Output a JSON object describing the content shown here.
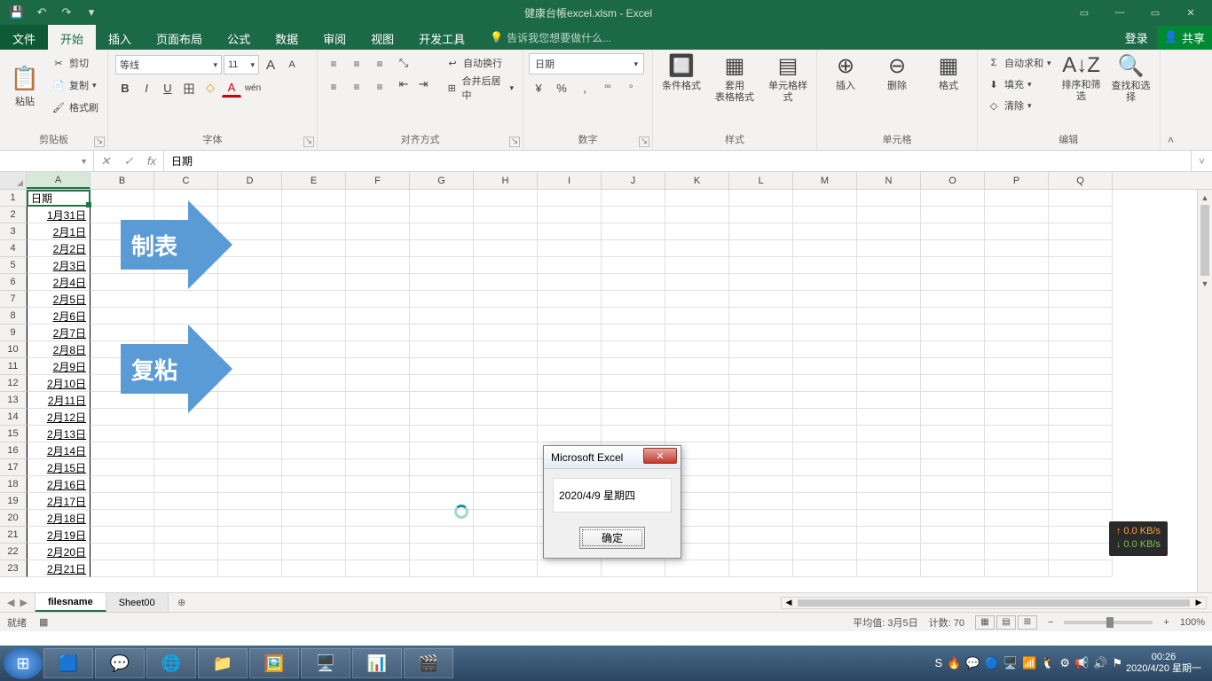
{
  "titlebar": {
    "filename": "健康台帳excel.xlsm - Excel"
  },
  "qat": {
    "save": "💾",
    "undo": "↶",
    "redo": "↷",
    "more": "▾"
  },
  "wincontrols": {
    "min": "—",
    "max": "▭",
    "close": "✕",
    "ribbonopts": "▭"
  },
  "menu": {
    "file": "文件",
    "home": "开始",
    "insert": "插入",
    "pagelayout": "页面布局",
    "formulas": "公式",
    "data": "数据",
    "review": "审阅",
    "view": "视图",
    "developer": "开发工具",
    "tellme": "告诉我您想要做什么...",
    "signin": "登录",
    "share": "共享"
  },
  "ribbon": {
    "clipboard": {
      "label": "剪贴板",
      "paste": "粘贴",
      "cut": "剪切",
      "copy": "复制",
      "painter": "格式刷",
      "paste_icon": "📋"
    },
    "font": {
      "label": "字体",
      "name": "等线",
      "size": "11",
      "bold": "B",
      "italic": "I",
      "underline": "U",
      "incfont": "A",
      "decfont": "A",
      "ruby": "wén",
      "border": "田",
      "fill": "▦",
      "color": "A"
    },
    "align": {
      "label": "对齐方式",
      "wrap": "自动换行",
      "merge": "合并后居中"
    },
    "number": {
      "label": "数字",
      "format": "日期",
      "currency": "¥",
      "percent": "%",
      "comma": ",",
      "inc": ".0→.00",
      "dec": ".00→.0"
    },
    "styles": {
      "label": "样式",
      "cond": "条件格式",
      "table": "套用\n表格格式",
      "cell": "单元格样式"
    },
    "cells": {
      "label": "单元格",
      "insert": "插入",
      "delete": "删除",
      "format": "格式"
    },
    "editing": {
      "label": "编辑",
      "sum": "自动求和",
      "fill": "填充",
      "clear": "清除",
      "sort": "排序和筛选",
      "find": "查找和选择"
    }
  },
  "namebox": "",
  "fx": {
    "cancel": "✕",
    "enter": "✓",
    "fx": "fx"
  },
  "formula": "日期",
  "columns": [
    "A",
    "B",
    "C",
    "D",
    "E",
    "F",
    "G",
    "H",
    "I",
    "J",
    "K",
    "L",
    "M",
    "N",
    "O",
    "P",
    "Q"
  ],
  "rownums": [
    "1",
    "2",
    "3",
    "4",
    "5",
    "6",
    "7",
    "8",
    "9",
    "10",
    "11",
    "12",
    "13",
    "14",
    "15",
    "16",
    "17",
    "18",
    "19",
    "20",
    "21",
    "22",
    "23"
  ],
  "colA": [
    "日期",
    "1月31日",
    "2月1日",
    "2月2日",
    "2月3日",
    "2月4日",
    "2月5日",
    "2月6日",
    "2月7日",
    "2月8日",
    "2月9日",
    "2月10日",
    "2月11日",
    "2月12日",
    "2月13日",
    "2月14日",
    "2月15日",
    "2月16日",
    "2月17日",
    "2月18日",
    "2月19日",
    "2月20日",
    "2月21日"
  ],
  "shapes": {
    "arrow1": "制表",
    "arrow2": "复粘"
  },
  "dialog": {
    "title": "Microsoft Excel",
    "msg": "2020/4/9 星期四",
    "ok": "确定"
  },
  "netmon": {
    "up": "↑ 0.0 KB/s",
    "down": "↓ 0.0 KB/s"
  },
  "sheets": {
    "s1": "filesname",
    "s2": "Sheet00",
    "add": "⊕",
    "nav_prev": "◀",
    "nav_next": "▶"
  },
  "status": {
    "ready": "就绪",
    "macro": "▦",
    "avg": "平均值: 3月5日",
    "count": "计数: 70",
    "zoom": "100%"
  },
  "taskbar": {
    "apps": [
      "🟦",
      "💬",
      "🌐",
      "📁",
      "🖼️",
      "🖥️",
      "📊",
      "🎬"
    ],
    "tray": [
      "S",
      "🔥",
      "💬",
      "🔵",
      "🖥️",
      "📶",
      "🐧",
      "⚙",
      "📢",
      "🔊",
      "⚑"
    ],
    "time": "00:26",
    "date": "2020/4/20 星期一"
  }
}
